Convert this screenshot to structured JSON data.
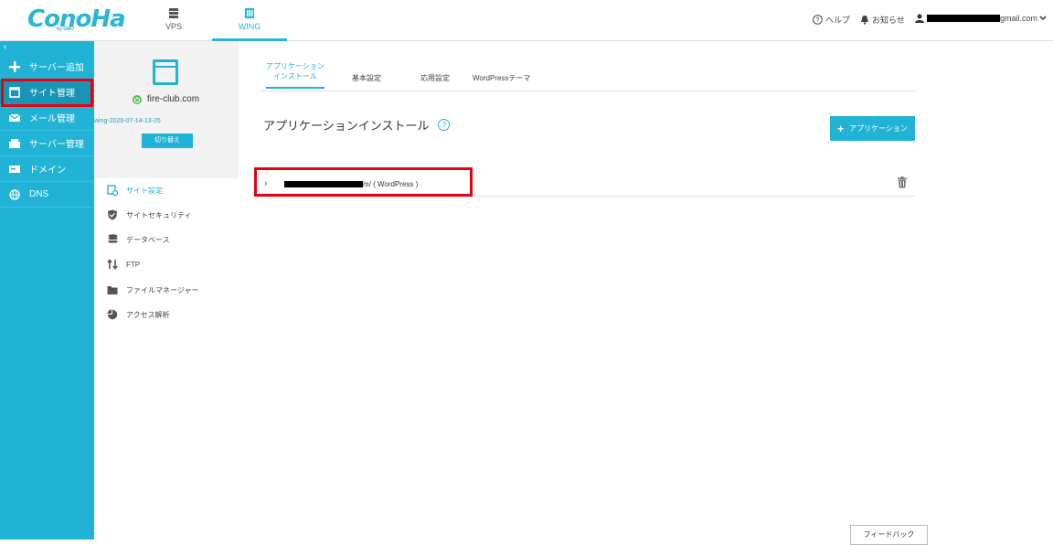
{
  "header": {
    "logo": "ConoHa",
    "logo_sub": "by GMO",
    "tabs": [
      {
        "label": "VPS"
      },
      {
        "label": "WING"
      }
    ],
    "help_label": "ヘルプ",
    "notifications_label": "お知らせ",
    "account_email_suffix": "gmail.com"
  },
  "sidebar": {
    "items": [
      {
        "label": "サーバー追加",
        "icon": "plus-icon"
      },
      {
        "label": "サイト管理",
        "icon": "window-icon"
      },
      {
        "label": "メール管理",
        "icon": "mail-icon"
      },
      {
        "label": "サーバー管理",
        "icon": "server-icon"
      },
      {
        "label": "ドメイン",
        "icon": "domain-icon"
      },
      {
        "label": "DNS",
        "icon": "globe-icon"
      }
    ]
  },
  "site_panel": {
    "site_name": "fire-club.com",
    "site_id": "wing-2020-07-14-13-25",
    "switch_label": "切り替え",
    "menu": [
      {
        "label": "サイト設定",
        "icon": "site-settings-icon"
      },
      {
        "label": "サイトセキュリティ",
        "icon": "shield-icon"
      },
      {
        "label": "データベース",
        "icon": "database-icon"
      },
      {
        "label": "FTP",
        "icon": "ftp-icon"
      },
      {
        "label": "ファイルマネージャー",
        "icon": "folder-icon"
      },
      {
        "label": "アクセス解析",
        "icon": "pie-chart-icon"
      }
    ]
  },
  "main": {
    "tabs": [
      {
        "line1": "アプリケーション",
        "line2": "インストール"
      },
      {
        "line1": "基本設定",
        "line2": ""
      },
      {
        "line1": "応用設定",
        "line2": ""
      },
      {
        "line1": "WordPressテーマ",
        "line2": ""
      }
    ],
    "title": "アプリケーションインストール",
    "add_button": "アプリケーション",
    "app_row": {
      "url_suffix": "m/ ( WordPress )"
    },
    "feedback_label": "フィードバック"
  },
  "colors": {
    "accent": "#21b3d6",
    "highlight": "#e60012"
  }
}
